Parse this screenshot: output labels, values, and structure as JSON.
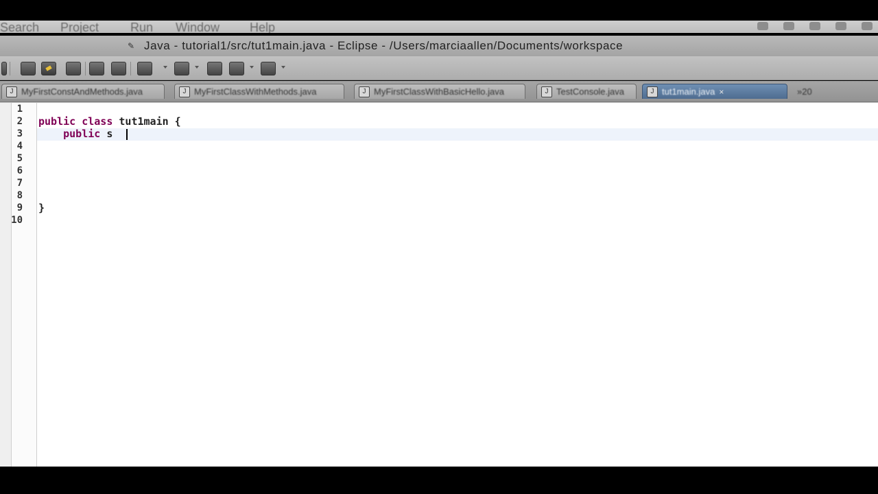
{
  "menubar": {
    "items": [
      "Search",
      "Project",
      "Run",
      "Window",
      "Help"
    ]
  },
  "window": {
    "title": "Java - tutorial1/src/tut1main.java - Eclipse - /Users/marciaallen/Documents/workspace"
  },
  "toolbar": {
    "buttons": [
      {
        "icon": "bug-icon"
      },
      {
        "icon": "highlight-icon"
      },
      {
        "icon": "external-tools-icon"
      },
      {
        "icon": "toggle-mark-icon"
      },
      {
        "icon": "show-whitespace-icon"
      },
      {
        "icon": "next-annotation-icon"
      },
      {
        "icon": "previous-annotation-icon"
      },
      {
        "icon": "back-icon"
      },
      {
        "icon": "forward-icon"
      },
      {
        "icon": "pin-icon"
      }
    ]
  },
  "tabs": [
    {
      "label": "MyFirstConstAndMethods.java",
      "active": false
    },
    {
      "label": "MyFirstClassWithMethods.java",
      "active": false
    },
    {
      "label": "MyFirstClassWithBasicHello.java",
      "active": false
    },
    {
      "label": "TestConsole.java",
      "active": false
    },
    {
      "label": "tut1main.java",
      "active": true,
      "close": "×"
    },
    {
      "label": "»20",
      "active": false
    }
  ],
  "editor": {
    "line_numbers": [
      "1",
      "2",
      "3",
      "4",
      "5",
      "6",
      "7",
      "8",
      "9",
      "10"
    ],
    "lines": [
      {
        "kw": "",
        "text": ""
      },
      {
        "kw": "public class",
        "text": " tut1main {"
      },
      {
        "kw": "    public",
        "text": " s"
      },
      {
        "kw": "",
        "text": ""
      },
      {
        "kw": "",
        "text": ""
      },
      {
        "kw": "",
        "text": ""
      },
      {
        "kw": "",
        "text": ""
      },
      {
        "kw": "",
        "text": ""
      },
      {
        "kw": "",
        "text": "}"
      },
      {
        "kw": "",
        "text": ""
      }
    ]
  },
  "colors": {
    "keyword": "#7f0055",
    "active_tab": "#4e6c90",
    "current_line": "#eef3fb"
  }
}
